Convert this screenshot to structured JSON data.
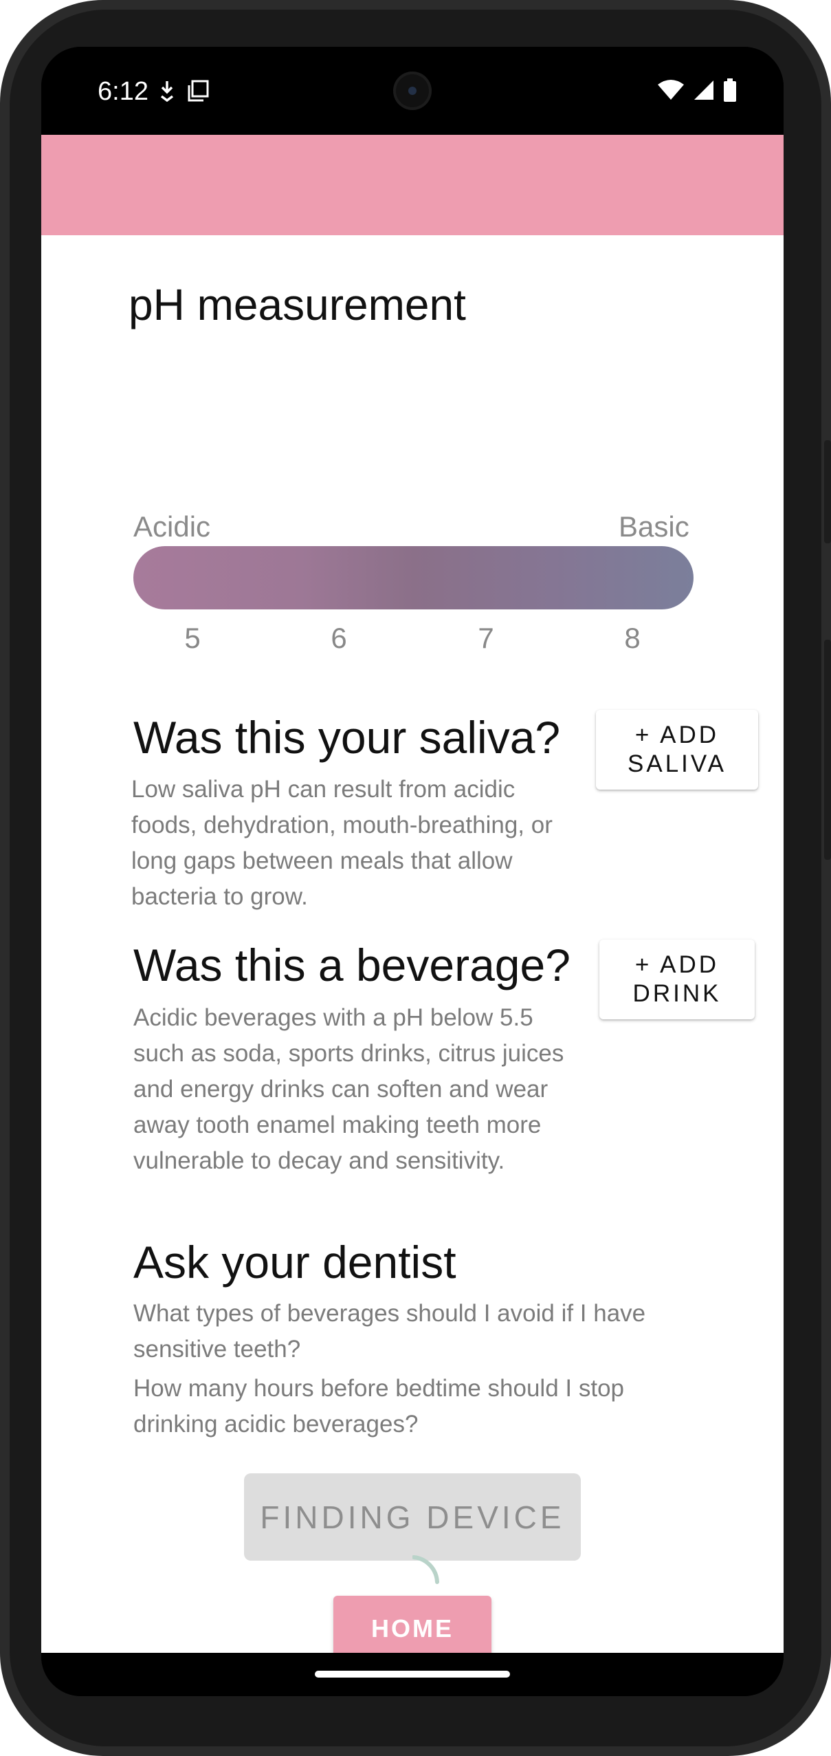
{
  "status_bar": {
    "time": "6:12",
    "left_icons": [
      "download-icon",
      "copy-icon"
    ],
    "right_icons": [
      "wifi-icon",
      "signal-icon",
      "battery-icon"
    ]
  },
  "page": {
    "title": "pH measurement"
  },
  "ph_scale": {
    "left_label": "Acidic",
    "right_label": "Basic",
    "ticks": [
      "5",
      "6",
      "7",
      "8"
    ],
    "gradient_start": "#a77b9b",
    "gradient_end": "#7b7f9b"
  },
  "saliva": {
    "title": "Was this your saliva?",
    "body": "Low saliva pH can result from acidic foods, dehydration, mouth-breathing, or long gaps between meals that allow bacteria to grow.",
    "button_line1": "+ ADD",
    "button_line2": "SALIVA"
  },
  "beverage": {
    "title": "Was this a beverage?",
    "body": "Acidic beverages with a pH below 5.5 such as soda, sports drinks, citrus juices and energy drinks can soften and wear away tooth enamel making teeth more vulnerable to decay and sensitivity.",
    "button_line1": "+ ADD",
    "button_line2": "DRINK"
  },
  "dentist": {
    "title": "Ask your dentist",
    "questions": [
      "What types of beverages should I avoid if I have sensitive teeth?",
      "How many hours before bedtime should I stop drinking acidic beverages?"
    ]
  },
  "actions": {
    "finding_label": "FINDING DEVICE",
    "home_label": "HOME"
  },
  "colors": {
    "accent": "#ee9db0",
    "disabled_button": "#dddddd",
    "spinner": "#b9d3c9"
  }
}
